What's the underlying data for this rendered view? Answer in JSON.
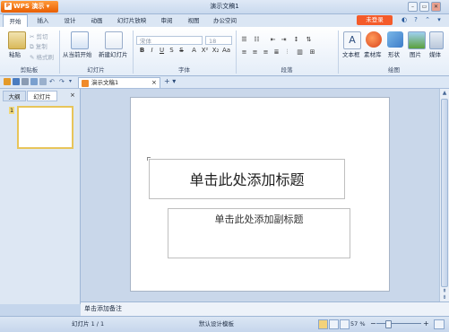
{
  "app": {
    "button_label": "WPS 演示",
    "logo_glyph": "P"
  },
  "window": {
    "title": "演示文稿1"
  },
  "ribbon_tabs": [
    "开始",
    "插入",
    "设计",
    "动画",
    "幻灯片放映",
    "审阅",
    "视图",
    "办公空间"
  ],
  "unregistered_label": "未登录",
  "clipboard": {
    "paste": "粘贴",
    "cut": "剪切",
    "copy": "复制",
    "format_painter": "格式刷",
    "group": "剪贴板"
  },
  "slides_group": {
    "from_current": "从当前开始",
    "new_slide": "新建幻灯片",
    "group": "幻灯片"
  },
  "font_group": {
    "font_name": "宋体",
    "font_size": "18",
    "group": "字体"
  },
  "paragraph_group": {
    "group": "段落"
  },
  "drawing_group": {
    "textbox": "文本框",
    "material": "素材库",
    "shapes": "形状",
    "picture": "图片",
    "media": "媒体",
    "group": "绘图"
  },
  "doc_tab": {
    "name": "演示文稿1"
  },
  "panel_tabs": [
    "大纲",
    "幻灯片"
  ],
  "thumbnail_number": "1",
  "slide": {
    "title_placeholder": "单击此处添加标题",
    "subtitle_placeholder": "单击此处添加副标题"
  },
  "notes_placeholder": "单击添加备注",
  "status": {
    "slide_info": "幻灯片 1 / 1",
    "template": "默认设计模板",
    "zoom": "57 %"
  }
}
